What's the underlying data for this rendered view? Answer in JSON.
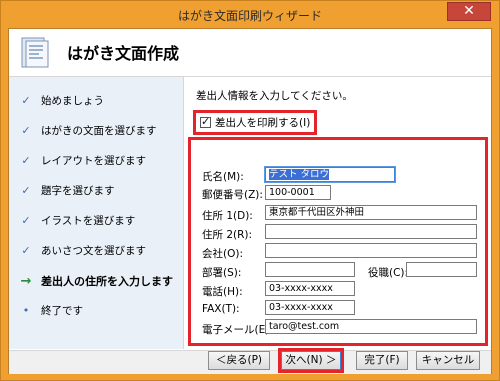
{
  "window": {
    "title": "はがき文面印刷ウィザード",
    "close_label": "✕"
  },
  "header": {
    "title": "はがき文面作成",
    "icon": "document-icon"
  },
  "steps": [
    {
      "label": "始めましょう",
      "mark": "✓",
      "current": false
    },
    {
      "label": "はがきの文面を選びます",
      "mark": "✓",
      "current": false
    },
    {
      "label": "レイアウトを選びます",
      "mark": "✓",
      "current": false
    },
    {
      "label": "題字を選びます",
      "mark": "✓",
      "current": false
    },
    {
      "label": "イラストを選びます",
      "mark": "✓",
      "current": false
    },
    {
      "label": "あいさつ文を選びます",
      "mark": "✓",
      "current": false
    },
    {
      "label": "差出人の住所を入力します",
      "mark": "→",
      "current": true
    },
    {
      "label": "終了です",
      "mark": "•",
      "current": false
    }
  ],
  "main": {
    "instruction": "差出人情報を入力してください。",
    "print_sender_checkbox": {
      "label": "差出人を印刷する(I)",
      "checked": true
    }
  },
  "fields": {
    "name": {
      "label": "氏名(M):",
      "value": "テスト タロウ"
    },
    "postal": {
      "label": "郵便番号(Z):",
      "value": "100-0001"
    },
    "address1": {
      "label": "住所 1(D):",
      "value": "東京都千代田区外神田"
    },
    "address2": {
      "label": "住所 2(R):",
      "value": ""
    },
    "company": {
      "label": "会社(O):",
      "value": ""
    },
    "department": {
      "label": "部署(S):",
      "value": ""
    },
    "position": {
      "label": "役職(C):",
      "value": ""
    },
    "phone": {
      "label": "電話(H):",
      "value": "03-xxxx-xxxx"
    },
    "fax": {
      "label": "FAX(T):",
      "value": "03-xxxx-xxxx"
    },
    "email": {
      "label": "電子メール(E):",
      "value": "taro@test.com"
    }
  },
  "footer": {
    "back": "＜戻る(P)",
    "next": "次へ(N) ＞",
    "finish": "完了(F)",
    "cancel": "キャンセル"
  },
  "colors": {
    "frame": "#f0a030",
    "highlight": "#e3242b",
    "sidebar": "#eaf0f8",
    "selection": "#3b6fd6"
  }
}
